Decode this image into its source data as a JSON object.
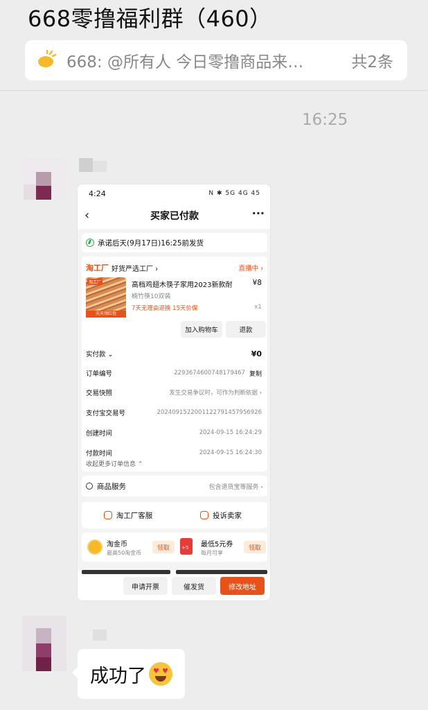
{
  "chat": {
    "title": "668零撸福利群（460）",
    "pinned_text": "668: @所有人 今日零撸商品来…",
    "pinned_count": "共2条",
    "time": "16:25"
  },
  "screenshot": {
    "status_time": "4:24",
    "status_icons": "N ✱ 5G 4G 45",
    "nav_title": "买家已付款",
    "promise": "承诺后天(9月17日)16:25前发货",
    "shop_logo": "淘工厂",
    "shop_name": "好货严选工厂 ›",
    "live": "直播中 ›",
    "product_img_tag": "淘工厂",
    "product_img_bottom": "天天领红包",
    "product_title": "高档鸡翅木筷子家用2023新款耐",
    "product_price": "¥8",
    "product_sku": "楠竹筷10双装",
    "product_tags": "7天无理由退换  15天价保",
    "product_qty": "x1",
    "btn_cart": "加入购物车",
    "btn_refund": "退款",
    "paid_label": "实付款 ⌄",
    "paid_value": "¥0",
    "order_no_label": "订单编号",
    "order_no_value": "2293674600748179467",
    "copy": "复制",
    "snapshot_label": "交易快照",
    "snapshot_value": "发生交易争议时，可作为判断依据 ›",
    "alipay_label": "支付宝交易号",
    "alipay_value": "2024091522001122791457956926",
    "created_label": "创建时间",
    "created_value": "2024-09-15 16:24:29",
    "paid_time_label": "付款时间",
    "paid_time_value": "2024-09-15 16:24:30",
    "more_info": "收起更多订单信息 ⌃",
    "service_label": "商品服务",
    "service_value": "包含退货宝等服务 ›",
    "cs_label": "淘工厂客服",
    "complain_label": "投诉卖家",
    "coin_title": "淘金币",
    "coin_sub": "最高50淘金币",
    "coupon_title": "最低5元券",
    "coupon_sub": "每月可享",
    "redpack_text": "+5",
    "claim": "领取",
    "btn_invoice": "申请开票",
    "btn_urge": "催发货",
    "btn_address": "修改地址"
  },
  "message": {
    "text": "成功了"
  },
  "colors": {
    "accent": "#e8521a",
    "chat_bg": "#ededed",
    "green": "#2bb24c"
  }
}
